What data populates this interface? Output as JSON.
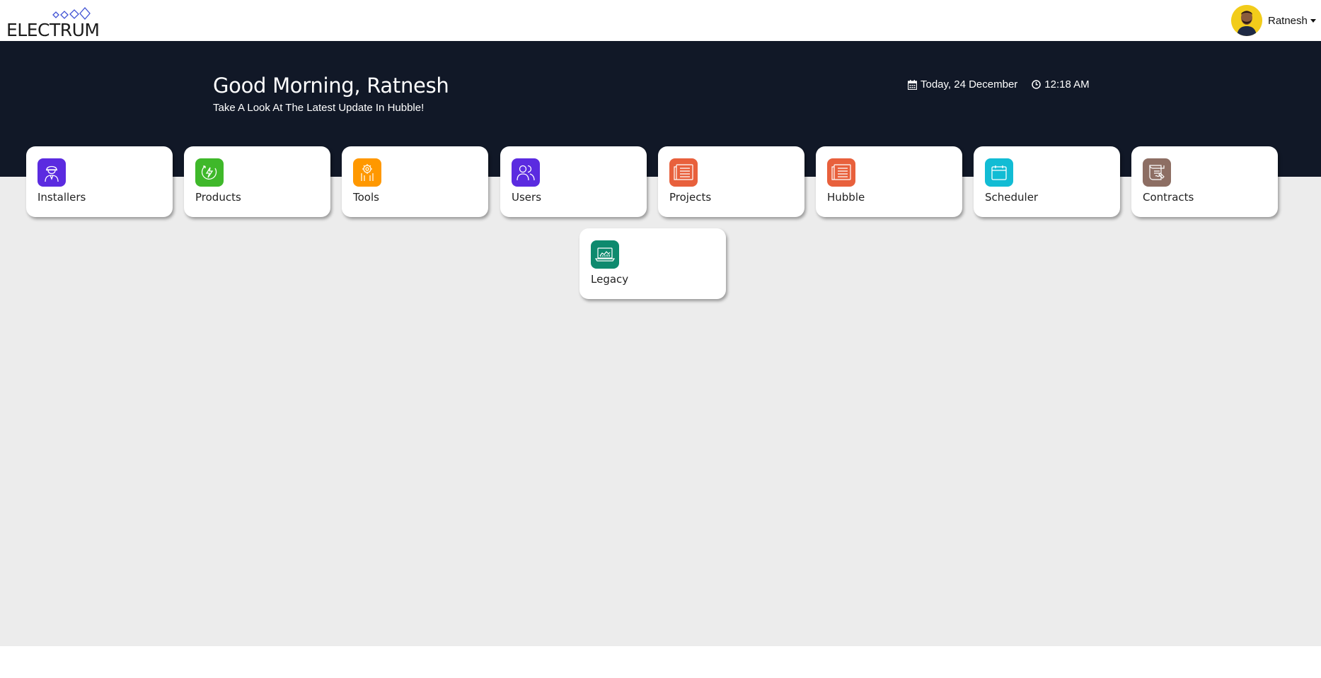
{
  "header": {
    "logo_text": "ELECTRUM",
    "user_name": "Ratnesh"
  },
  "hero": {
    "greeting": "Good Morning, Ratnesh",
    "subtitle": "Take A Look At The Latest Update In Hubble!",
    "date": "Today, 24 December",
    "time": "12:18 AM"
  },
  "modules": [
    {
      "label": "Installers",
      "icon": "installer-icon",
      "color": "#5b2be0"
    },
    {
      "label": "Products",
      "icon": "lightning-icon",
      "color": "#3fb82a"
    },
    {
      "label": "Tools",
      "icon": "tools-icon",
      "color": "#ff9800"
    },
    {
      "label": "Users",
      "icon": "users-icon",
      "color": "#5b2be0"
    },
    {
      "label": "Projects",
      "icon": "document-icon",
      "color": "#e8603c"
    },
    {
      "label": "Hubble",
      "icon": "document-icon",
      "color": "#e8603c"
    },
    {
      "label": "Scheduler",
      "icon": "calendar-icon",
      "color": "#12bcd4"
    },
    {
      "label": "Contracts",
      "icon": "contract-icon",
      "color": "#8d6e63"
    },
    {
      "label": "Legacy",
      "icon": "laptop-chart-icon",
      "color": "#0e8a6e"
    }
  ],
  "colors": {
    "hero_bg": "#111827",
    "page_bg": "#ececec",
    "logo_accent": "#3f51d4"
  }
}
